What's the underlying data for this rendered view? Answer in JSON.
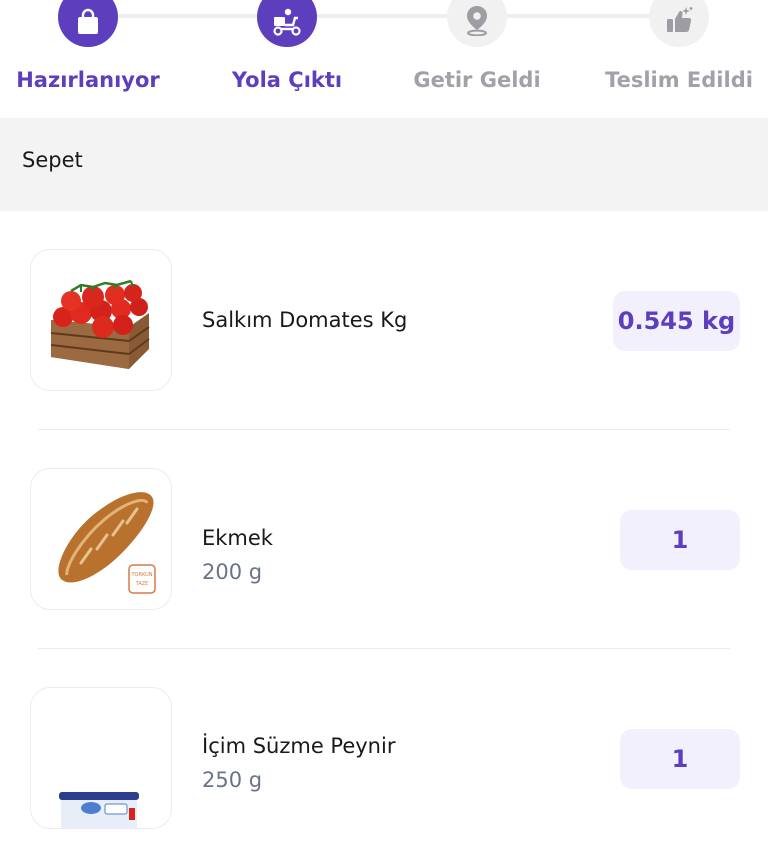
{
  "order_status": {
    "steps": [
      {
        "label": "Hazırlanıyor",
        "icon": "shopping-bag-icon",
        "state": "done"
      },
      {
        "label": "Yola Çıktı",
        "icon": "courier-scooter-icon",
        "state": "active"
      },
      {
        "label": "Getir Geldi",
        "icon": "location-pin-icon",
        "state": "pending"
      },
      {
        "label": "Teslim Edildi",
        "icon": "thumbs-up-icon",
        "state": "pending"
      }
    ]
  },
  "basket": {
    "title": "Sepet",
    "items": [
      {
        "name": "Salkım Domates Kg",
        "detail": "",
        "quantity": "0.545 kg",
        "image": "tomatoes-in-crate"
      },
      {
        "name": "Ekmek",
        "detail": "200 g",
        "quantity": "1",
        "image": "bread-loaf"
      },
      {
        "name": "İçim Süzme Peynir",
        "detail": "250 g",
        "quantity": "1",
        "image": "cheese-package"
      }
    ]
  },
  "colors": {
    "accent": "#5d3ebc",
    "inactive_text": "#a1a1a8",
    "qty_background": "#f3f0fe",
    "section_background": "#f3f3f3",
    "secondary_text": "#697488"
  }
}
